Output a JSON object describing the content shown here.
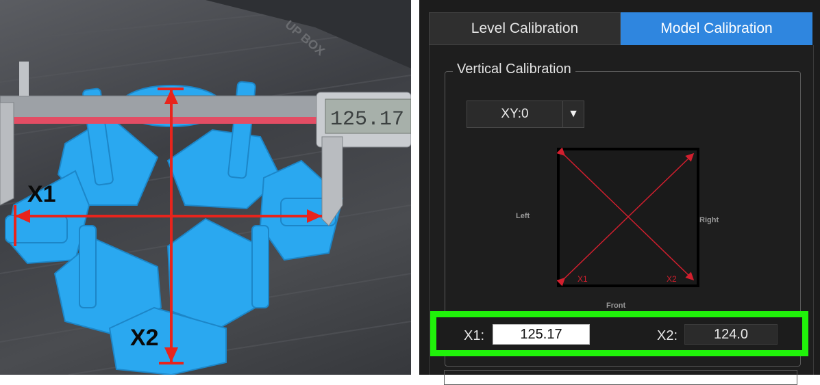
{
  "photo": {
    "caliper_reading": "125.17",
    "printer_brand": "UP BOX",
    "labels": {
      "x1": "X1",
      "x2": "X2"
    }
  },
  "tabs": [
    {
      "label": "Level Calibration",
      "active": false
    },
    {
      "label": "Model Calibration",
      "active": true
    }
  ],
  "group": {
    "title": "Vertical Calibration"
  },
  "axis_select": {
    "value": "XY:0",
    "arrow": "▼"
  },
  "diagram": {
    "left_label": "Left",
    "right_label": "Right",
    "front_label": "Front",
    "x1_tag": "X1",
    "x2_tag": "X2"
  },
  "measure": {
    "x1_label": "X1:",
    "x1_value": "125.17",
    "x2_label": "X2:",
    "x2_value": "124.0"
  },
  "colors": {
    "accent_tab": "#2f86df",
    "highlight_box": "#20f20a",
    "diagram_lines": "#d21f2e",
    "print_blue": "#2aa8f0",
    "annotation_red": "#e8241c"
  }
}
